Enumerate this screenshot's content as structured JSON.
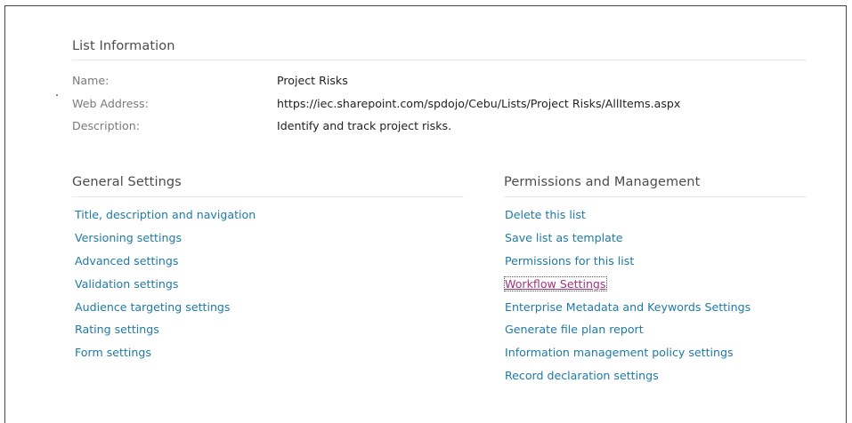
{
  "list_information": {
    "title": "List Information",
    "name_label": "Name:",
    "name_value": "Project Risks",
    "web_address_label": "Web Address:",
    "web_address_value": "https://iec.sharepoint.com/spdojo/Cebu/Lists/Project Risks/AllItems.aspx",
    "description_label": "Description:",
    "description_value": "Identify and track project risks."
  },
  "general_settings": {
    "title": "General Settings",
    "links": [
      "Title, description and navigation",
      "Versioning settings",
      "Advanced settings",
      "Validation settings",
      "Audience targeting settings",
      "Rating settings",
      "Form settings"
    ]
  },
  "permissions_management": {
    "title": "Permissions and Management",
    "links": [
      "Delete this list",
      "Save list as template",
      "Permissions for this list",
      "Workflow Settings",
      "Enterprise Metadata and Keywords Settings",
      "Generate file plan report",
      "Information management policy settings",
      "Record declaration settings"
    ]
  },
  "colors": {
    "link": "#1e7aa6",
    "visited_link": "#a0347e",
    "label": "#7a7a7a",
    "heading": "#4c4c4c"
  }
}
